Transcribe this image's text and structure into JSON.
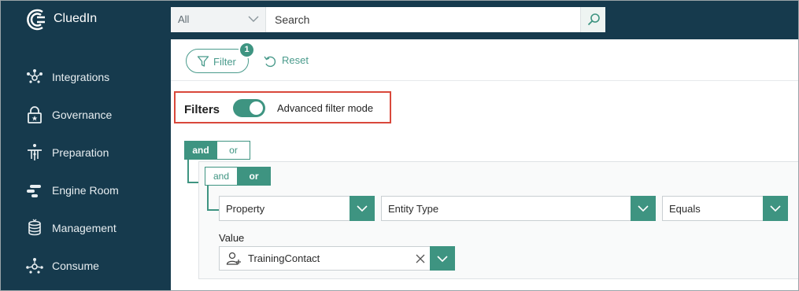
{
  "app": {
    "brand": "CluedIn"
  },
  "search": {
    "scope": "All",
    "placeholder": "Search"
  },
  "sidebar": {
    "items": [
      {
        "label": "Integrations",
        "icon": "integrations-icon"
      },
      {
        "label": "Governance",
        "icon": "governance-lock-icon"
      },
      {
        "label": "Preparation",
        "icon": "preparation-icon"
      },
      {
        "label": "Engine Room",
        "icon": "engine-room-icon"
      },
      {
        "label": "Management",
        "icon": "management-database-icon"
      },
      {
        "label": "Consume",
        "icon": "consume-icon"
      }
    ]
  },
  "toolbar": {
    "filter_label": "Filter",
    "filter_count": "1",
    "reset_label": "Reset"
  },
  "filters": {
    "title": "Filters",
    "advanced_mode_label": "Advanced filter mode",
    "advanced_mode_on": true,
    "outer_group": {
      "and_label": "and",
      "or_label": "or",
      "selected": "and"
    },
    "inner_group": {
      "and_label": "and",
      "or_label": "or",
      "selected": "or"
    },
    "rule": {
      "field_type": "Property",
      "field": "Entity Type",
      "operator": "Equals",
      "value_label": "Value",
      "value": "TrainingContact"
    }
  },
  "colors": {
    "accent": "#3e9481",
    "sidebar_bg": "#163a4d",
    "highlight": "#d9483b"
  }
}
